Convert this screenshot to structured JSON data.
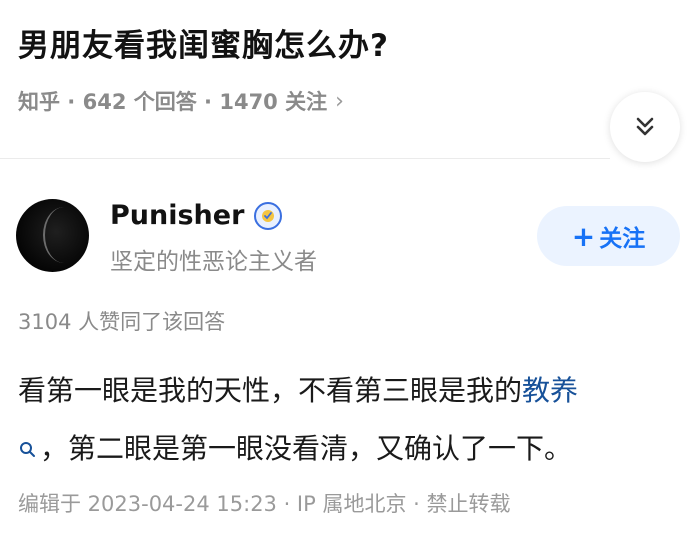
{
  "question": {
    "title": "男朋友看我闺蜜胸怎么办?",
    "meta": "知乎 · 642 个回答 · 1470 关注",
    "meta_chevron": "›"
  },
  "answer": {
    "author": {
      "name": "Punisher",
      "bio": "坚定的性恶论主义者",
      "follow_label": "关注",
      "follow_icon": "+"
    },
    "likes_text": "3104 人赞同了该回答",
    "content": {
      "part1": "看第一眼是我的天性，不看第三眼是我的",
      "link_text": "教养",
      "part2": "，第二眼是第一眼没看清，又确认了一下。"
    },
    "footer": "编辑于 2023-04-24 15:23 · IP 属地北京 · 禁止转载"
  },
  "icons": {
    "expand": "chevrons-down-icon",
    "badge": "verified-badge-icon",
    "search": "search-icon"
  },
  "colors": {
    "accent": "#1772f6",
    "link": "#175199",
    "muted": "#8a8a8a"
  }
}
